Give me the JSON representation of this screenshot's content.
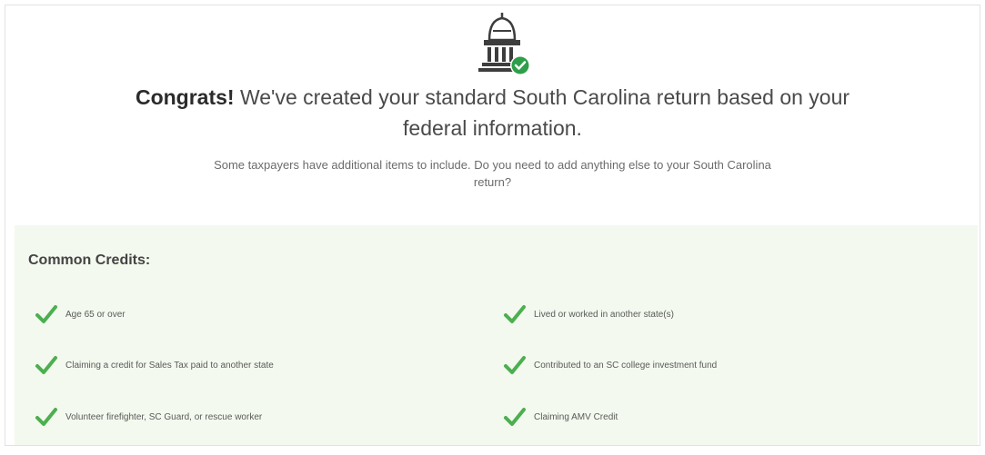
{
  "headline": {
    "bold": "Congrats!",
    "line1_rest": " We've created your standard South Carolina return based on your",
    "line2": "federal information."
  },
  "subtext": {
    "line1": "Some taxpayers have additional items to include. Do you need to add anything else to your South Carolina",
    "line2": "return?"
  },
  "credits": {
    "title": "Common Credits:",
    "left_items": [
      "Age 65 or over",
      "Claiming a credit for Sales Tax paid to another state",
      "Volunteer firefighter, SC Guard, or rescue worker"
    ],
    "right_items": [
      "Lived or worked in another state(s)",
      "Contributed to an SC college investment fund",
      "Claiming AMV Credit"
    ]
  },
  "colors": {
    "check_green": "#4caf50",
    "badge_green": "#2e9e4a",
    "panel_bg": "#f3f9ee"
  },
  "icons": {
    "hero": "capitol-building-with-check-icon",
    "item": "green-checkmark-icon"
  }
}
